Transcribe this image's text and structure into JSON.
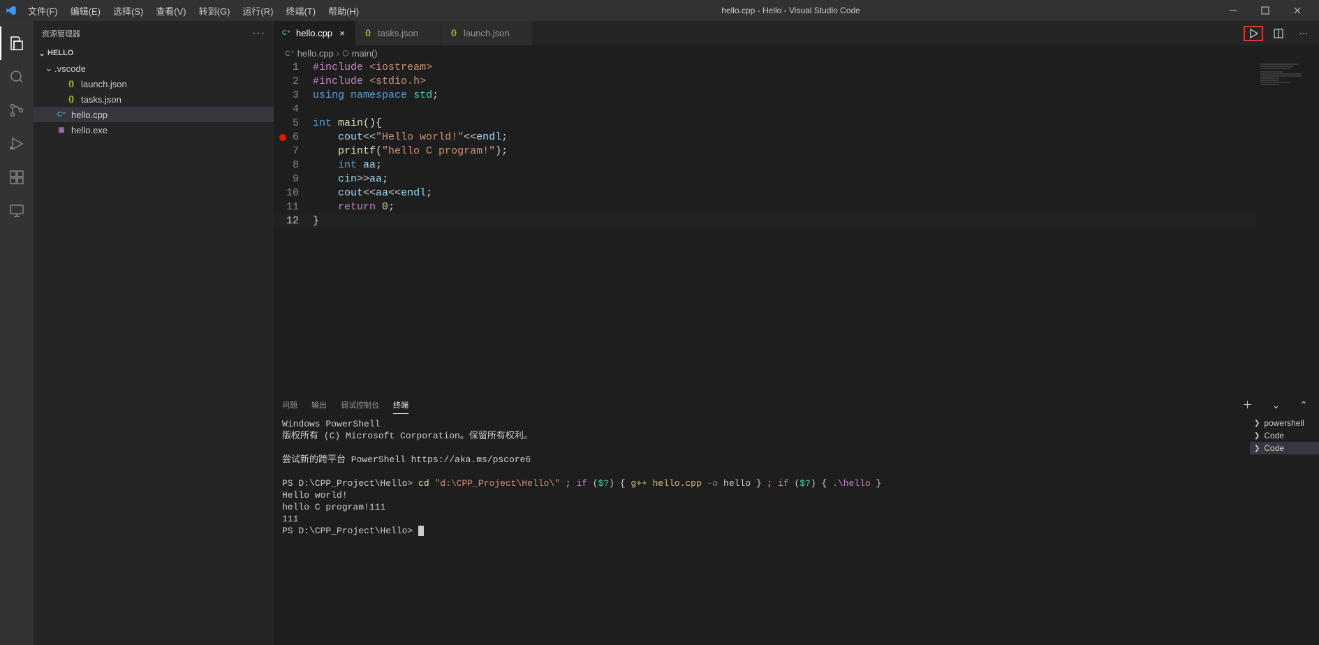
{
  "app": {
    "title": "hello.cpp - Hello - Visual Studio Code"
  },
  "menubar": [
    "文件(F)",
    "编辑(E)",
    "选择(S)",
    "查看(V)",
    "转到(G)",
    "运行(R)",
    "终端(T)",
    "帮助(H)"
  ],
  "sidebar": {
    "header": "资源管理器",
    "project": "HELLO",
    "folder": ".vscode",
    "folder_files": [
      "launch.json",
      "tasks.json"
    ],
    "root_files": [
      {
        "name": "hello.cpp",
        "type": "cpp",
        "active": true
      },
      {
        "name": "hello.exe",
        "type": "exe",
        "active": false
      }
    ]
  },
  "tabs": [
    {
      "name": "hello.cpp",
      "icon": "cpp",
      "active": true,
      "closable": true
    },
    {
      "name": "tasks.json",
      "icon": "json",
      "active": false,
      "closable": false
    },
    {
      "name": "launch.json",
      "icon": "json",
      "active": false,
      "closable": false
    }
  ],
  "breadcrumb": {
    "file": "hello.cpp",
    "symbol": "main()"
  },
  "code": {
    "lines": 12,
    "breakpoint_line": 6,
    "current_line": 12
  },
  "panel": {
    "tabs": [
      "问题",
      "输出",
      "调试控制台",
      "终端"
    ],
    "active": 3,
    "terminals": [
      "powershell",
      "Code",
      "Code"
    ],
    "terminal_active": 2
  },
  "terminal": {
    "line1": "Windows PowerShell",
    "line2": "版权所有 (C) Microsoft Corporation。保留所有权利。",
    "line3": "尝试新的跨平台 PowerShell https://aka.ms/pscore6",
    "prompt": "PS D:\\CPP_Project\\Hello>",
    "cmd_cd": "cd",
    "cmd_path": "\"d:\\CPP_Project\\Hello\\\"",
    "cmd_if": "if",
    "cmd_cond": "$?",
    "cmd_gpp": "g++ hello.cpp",
    "cmd_o": "-o",
    "cmd_out": "hello",
    "cmd_run": ".\\hello",
    "out1": "Hello world!",
    "out2": "hello C program!111",
    "out3": "111"
  }
}
